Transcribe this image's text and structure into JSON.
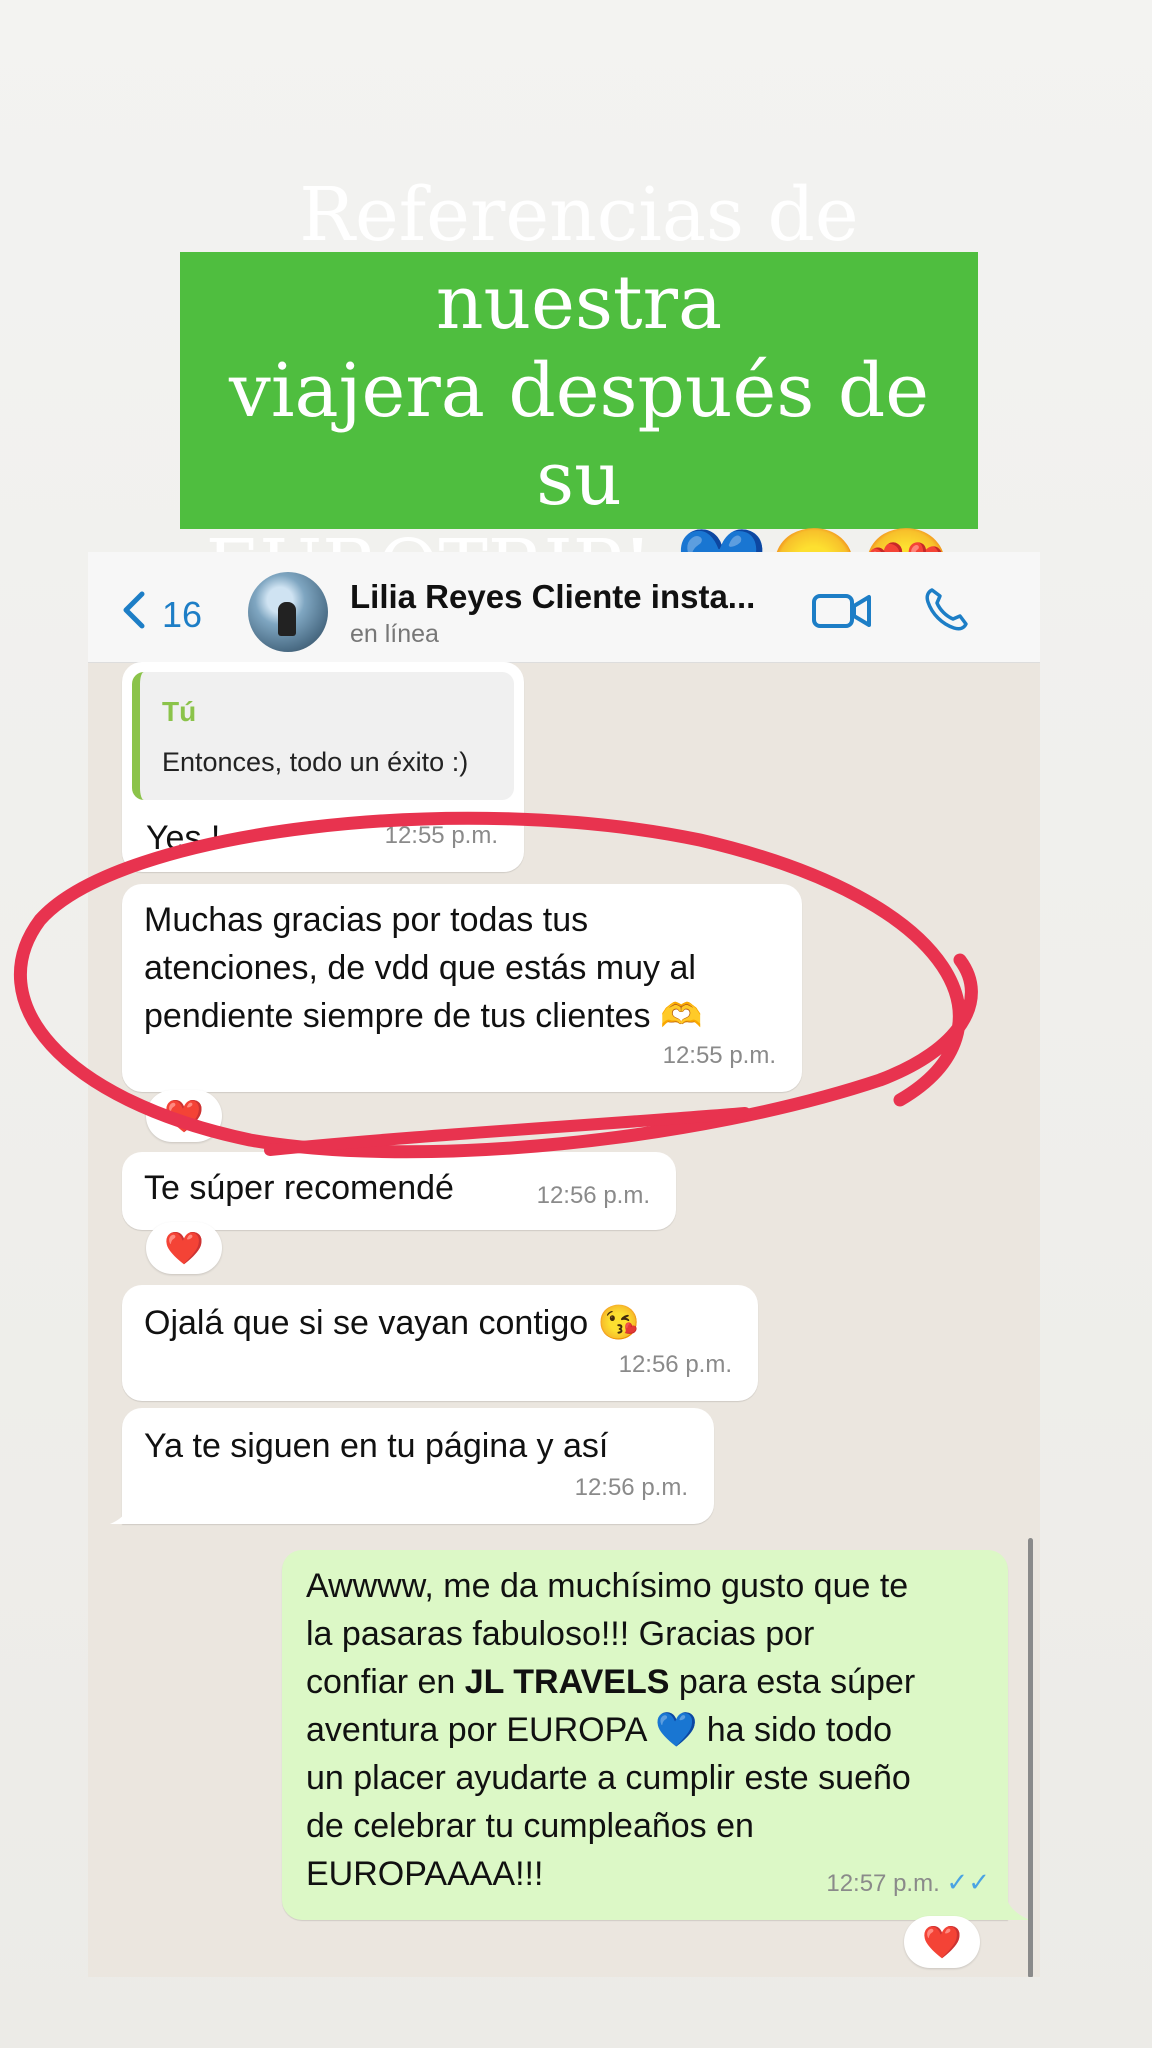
{
  "banner": {
    "line1": "Referencias de nuestra",
    "line2": "viajera después de su",
    "line3": "EUROTRIP! 💙😊😍"
  },
  "header": {
    "back_count": "16",
    "contact_name": "Lilia Reyes Cliente insta...",
    "status": "en línea"
  },
  "messages": [
    {
      "quote_author": "Tú",
      "quote_text": "Entonces, todo un éxito :)",
      "text": "Yes !",
      "time": "12:55 p.m."
    },
    {
      "text": "Muchas gracias por todas tus\natenciones, de vdd que estás muy al\npendiente siempre de tus clientes 🫶",
      "time": "12:55 p.m.",
      "reaction": "❤️"
    },
    {
      "text": "Te súper recomendé",
      "time": "12:56 p.m.",
      "reaction": "❤️"
    },
    {
      "text": "Ojalá que si se vayan contigo 😘",
      "time": "12:56 p.m."
    },
    {
      "text": "Ya te siguen en tu página y así",
      "time": "12:56 p.m."
    },
    {
      "text_before": "Awwww, me da muchísimo gusto que te\nla pasaras fabuloso!!! Gracias por\nconfiar en ",
      "text_bold": " JL TRAVELS",
      "text_after": " para esta súper\naventura por EUROPA 💙 ha sido todo\nun placer ayudarte a cumplir este sueño\nde celebrar tu cumpleaños en\nEUROPAAAA!!!",
      "time": "12:57 p.m.",
      "ticks": "✓✓",
      "reaction": "❤️"
    }
  ],
  "colors": {
    "banner_green": "#4fbe3f",
    "accent_blue": "#1d7ec6",
    "outgoing_bubble": "#dcf8c6",
    "highlight_circle": "#e8334f"
  }
}
